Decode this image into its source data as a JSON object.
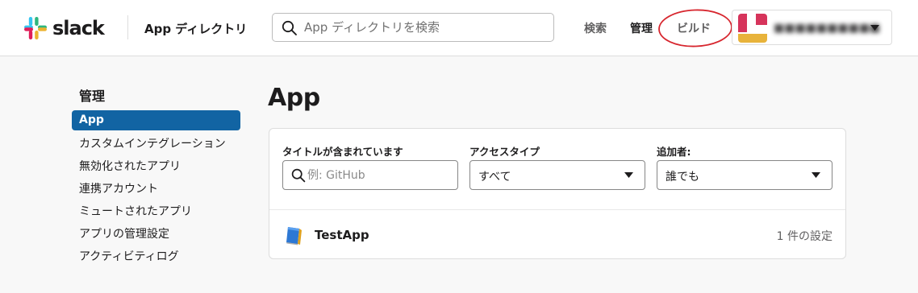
{
  "header": {
    "logo_text": "slack",
    "section_title": "App ディレクトリ",
    "search": {
      "placeholder": "App ディレクトリを検索",
      "value": ""
    },
    "nav": {
      "search": "検索",
      "manage": "管理",
      "build": "ビルド"
    },
    "workspace": {
      "name": "■■■■■■■■■■",
      "caret_icon": "caret-down-icon"
    }
  },
  "colors": {
    "accent": "#1264a3",
    "annotation_circle": "#d7262e",
    "avatar_red": "#d6345b",
    "avatar_yellow": "#e8b33b"
  },
  "sidebar": {
    "heading": "管理",
    "items": [
      {
        "label": "App",
        "active": true
      },
      {
        "label": "カスタムインテグレーション"
      },
      {
        "label": "無効化されたアプリ"
      },
      {
        "label": "連携アカウント"
      },
      {
        "label": "ミュートされたアプリ"
      },
      {
        "label": "アプリの管理設定"
      },
      {
        "label": "アクティビティログ"
      }
    ]
  },
  "main": {
    "title": "App",
    "filters": {
      "title_label": "タイトルが含まれています",
      "title_placeholder": "例: GitHub",
      "title_value": "",
      "access_label": "アクセスタイプ",
      "access_value": "すべて",
      "added_label": "追加者:",
      "added_value": "誰でも"
    },
    "apps": [
      {
        "name": "TestApp",
        "config": "1 件の設定",
        "icon": "book-icon"
      }
    ]
  }
}
